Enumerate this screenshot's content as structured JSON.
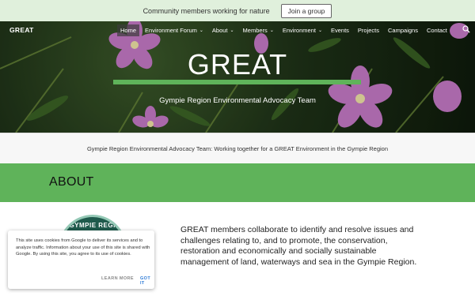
{
  "announcement": {
    "text": "Community members working for nature",
    "button": "Join a group"
  },
  "nav": {
    "brand": "GREAT",
    "items": [
      {
        "label": "Home",
        "dropdown": false,
        "active": true
      },
      {
        "label": "Environment Forum",
        "dropdown": true,
        "active": false
      },
      {
        "label": "About",
        "dropdown": true,
        "active": false
      },
      {
        "label": "Members",
        "dropdown": true,
        "active": false
      },
      {
        "label": "Environment",
        "dropdown": true,
        "active": false
      },
      {
        "label": "Events",
        "dropdown": false,
        "active": false
      },
      {
        "label": "Projects",
        "dropdown": false,
        "active": false
      },
      {
        "label": "Campaigns",
        "dropdown": false,
        "active": false
      },
      {
        "label": "Contact",
        "dropdown": false,
        "active": false
      }
    ]
  },
  "hero": {
    "title": "GREAT",
    "subtitle": "Gympie Region Environmental Advocacy Team"
  },
  "tagline": "Gympie Region Environmental Advocacy Team: Working together for a GREAT Environment in the Gympie Region",
  "about": {
    "heading": "ABOUT",
    "body": "GREAT members collaborate to identify and resolve issues and challenges relating to, and to promote, the conservation, restoration and economically and socially sustainable management of land, waterways and sea in the Gympie Region."
  },
  "logo": {
    "text": "GYMPIE REGIO"
  },
  "cookie_notice": {
    "text": "This site uses cookies from Google to deliver its services and to analyze traffic. Information about your use of this site is shared with Google. By using this site, you agree to its use of cookies.",
    "learn_more": "LEARN MORE",
    "got_it": "GOT IT"
  },
  "colors": {
    "accent_green": "#5fb35a",
    "announcement_bg": "#e0f0dc",
    "link_blue": "#2e7bd6"
  }
}
